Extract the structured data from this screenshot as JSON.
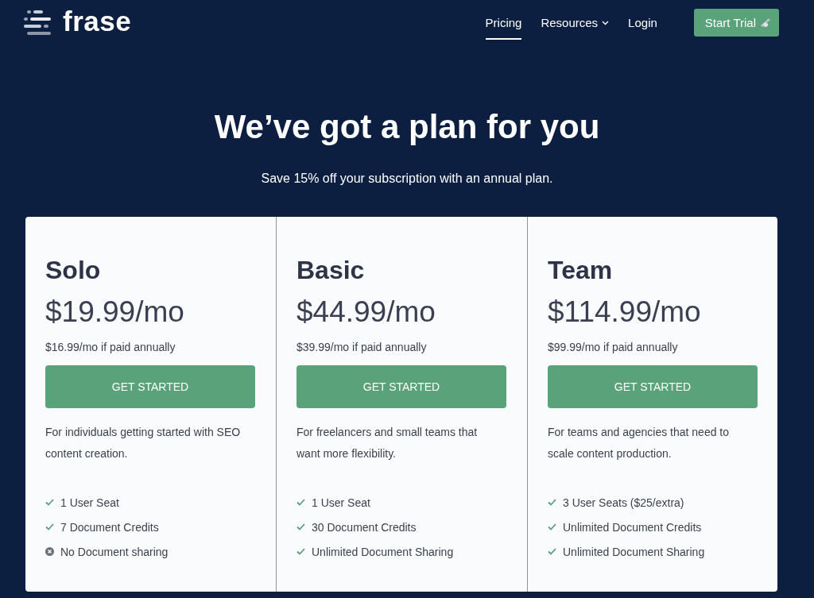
{
  "nav": {
    "logo": {
      "text": "frase"
    },
    "links": [
      {
        "label": "Pricing",
        "selected": true,
        "dropdown": false
      },
      {
        "label": "Resources",
        "selected": false,
        "dropdown": true
      },
      {
        "label": "Login",
        "selected": false,
        "dropdown": false
      }
    ],
    "cta": {
      "label": "Start Trial"
    }
  },
  "hero": {
    "title": "We’ve got a plan for you",
    "subtitle": "Save 15% off your subscription with an annual plan."
  },
  "plans": [
    {
      "name": "Solo",
      "price": "$19.99/mo",
      "annual_price": "$16.99/mo if paid annually",
      "button": "GET STARTED",
      "description": "For individuals getting started with SEO content creation.",
      "features": [
        {
          "text": "1 User Seat",
          "included": true
        },
        {
          "text": "7 Document Credits",
          "included": true
        },
        {
          "text": "No Document sharing",
          "included": false
        }
      ]
    },
    {
      "name": "Basic",
      "price": "$44.99/mo",
      "annual_price": "$39.99/mo if paid annually",
      "button": "GET STARTED",
      "description": "For freelancers and small teams that want more flexibility.",
      "features": [
        {
          "text": "1 User Seat",
          "included": true
        },
        {
          "text": "30 Document Credits",
          "included": true
        },
        {
          "text": "Unlimited Document Sharing",
          "included": true
        }
      ]
    },
    {
      "name": "Team",
      "price": "$114.99/mo",
      "annual_price": "$99.99/mo if paid annually",
      "button": "GET STARTED",
      "description": "For teams and agencies that need to scale content production.",
      "features": [
        {
          "text": "3 User Seats ($25/extra)",
          "included": true
        },
        {
          "text": "Unlimited Document Credits",
          "included": true
        },
        {
          "text": "Unlimited Document Sharing",
          "included": true
        }
      ]
    }
  ]
}
